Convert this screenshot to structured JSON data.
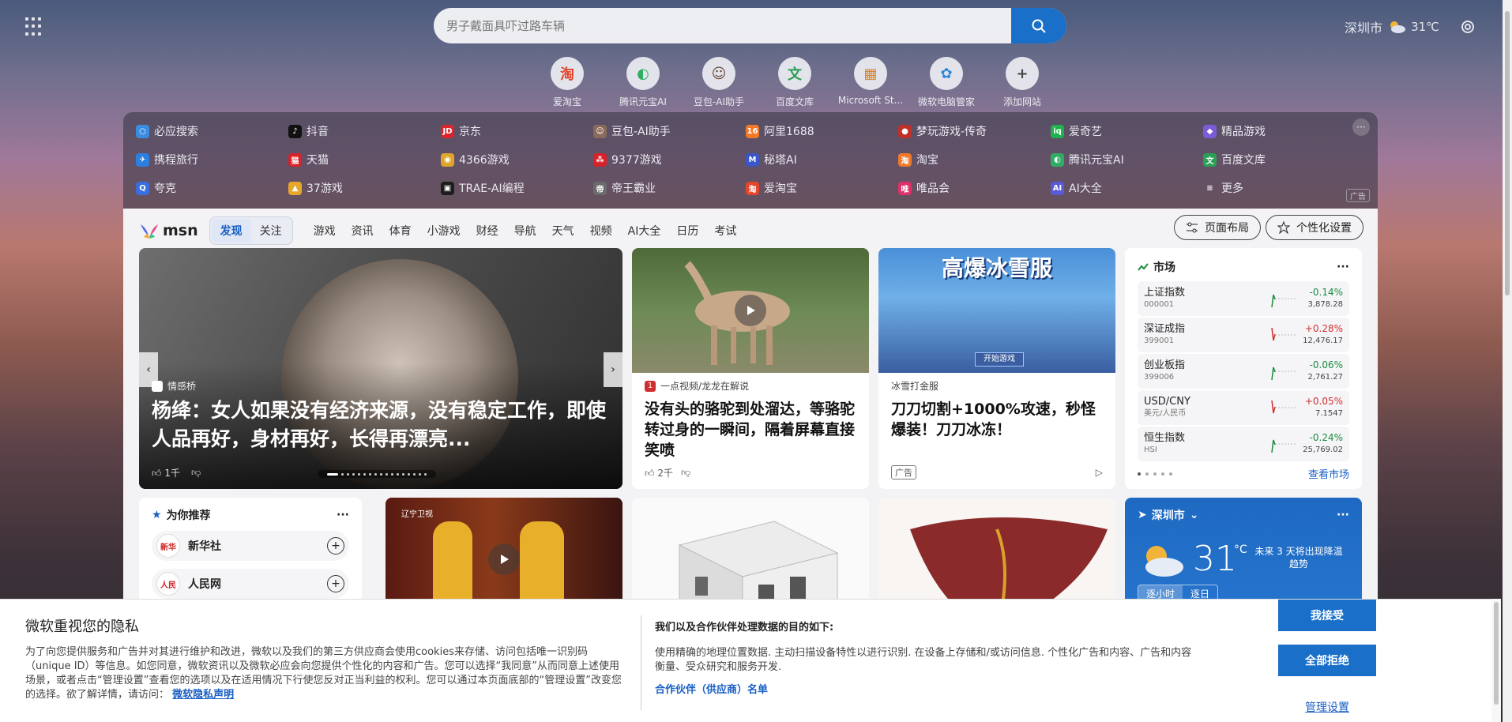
{
  "search": {
    "placeholder": "男子戴面具吓过路车辆"
  },
  "weather_top": {
    "city": "深圳市",
    "temp": "31℃"
  },
  "quick_links": [
    {
      "label": "爱淘宝",
      "glyph": "淘",
      "color": "#e2462b"
    },
    {
      "label": "腾讯元宝AI",
      "glyph": "◐",
      "color": "#2fae62"
    },
    {
      "label": "豆包-AI助手",
      "glyph": "☺",
      "color": "#6a4a3a"
    },
    {
      "label": "百度文库",
      "glyph": "文",
      "color": "#2aa055"
    },
    {
      "label": "Microsoft St...",
      "glyph": "▦",
      "color": "#d8842a"
    },
    {
      "label": "微软电脑管家",
      "glyph": "✿",
      "color": "#2b8ad8"
    },
    {
      "label": "添加网站",
      "glyph": "+",
      "color": "#444444"
    }
  ],
  "nav_grid": {
    "rows": [
      [
        {
          "label": "必应搜索",
          "glyph": "○",
          "color": "#3b8be0"
        },
        {
          "label": "抖音",
          "glyph": "♪",
          "color": "#111111"
        },
        {
          "label": "京东",
          "glyph": "JD",
          "color": "#d9262c"
        },
        {
          "label": "豆包-AI助手",
          "glyph": "☺",
          "color": "#8a6a5a"
        },
        {
          "label": "阿里1688",
          "glyph": "16",
          "color": "#f07a2a"
        },
        {
          "label": "梦玩游戏-传奇",
          "glyph": "●",
          "color": "#c0302a"
        },
        {
          "label": "爱奇艺",
          "glyph": "iq",
          "color": "#1fb14c"
        },
        {
          "label": "精品游戏",
          "glyph": "◆",
          "color": "#7b5cd6"
        }
      ],
      [
        {
          "label": "携程旅行",
          "glyph": "✈",
          "color": "#2a7fe0"
        },
        {
          "label": "天猫",
          "glyph": "猫",
          "color": "#d8222a"
        },
        {
          "label": "4366游戏",
          "glyph": "◉",
          "color": "#e0a62a"
        },
        {
          "label": "9377游戏",
          "glyph": "⁂",
          "color": "#d8222a"
        },
        {
          "label": "秘塔AI",
          "glyph": "M",
          "color": "#3a56c8"
        },
        {
          "label": "淘宝",
          "glyph": "淘",
          "color": "#f07a2a"
        },
        {
          "label": "腾讯元宝AI",
          "glyph": "◐",
          "color": "#2fae62"
        },
        {
          "label": "百度文库",
          "glyph": "文",
          "color": "#2aa055"
        }
      ],
      [
        {
          "label": "夸克",
          "glyph": "Q",
          "color": "#3a6ee0"
        },
        {
          "label": "37游戏",
          "glyph": "▲",
          "color": "#e6a72a"
        },
        {
          "label": "TRAE-AI编程",
          "glyph": "▣",
          "color": "#1d1d1d"
        },
        {
          "label": "帝王霸业",
          "glyph": "帝",
          "color": "#6b6b6b"
        },
        {
          "label": "爱淘宝",
          "glyph": "淘",
          "color": "#e2462b"
        },
        {
          "label": "唯品会",
          "glyph": "唯",
          "color": "#e0306a"
        },
        {
          "label": "AI大全",
          "glyph": "AI",
          "color": "#5a5ad8"
        },
        {
          "label": "更多",
          "glyph": "≡",
          "color": "transparent"
        }
      ]
    ],
    "ad_label": "广告"
  },
  "msn": {
    "logo_text": "msn",
    "tabs": [
      "发现",
      "关注"
    ],
    "categories": [
      "游戏",
      "资讯",
      "体育",
      "小游戏",
      "财经",
      "导航",
      "天气",
      "视频",
      "AI大全",
      "日历",
      "考试"
    ],
    "layout_btn": "页面布局",
    "personalize_btn": "个性化设置"
  },
  "hero": {
    "source": "情感桥",
    "title": "杨绛：女人如果没有经济来源，没有稳定工作，即使人品再好，身材再好，长得再漂亮...",
    "likes": "1千"
  },
  "camel_card": {
    "source": "一点视频/龙龙在解说",
    "title": "没有头的骆驼到处溜达，等骆驼转过身的一瞬间，隔着屏幕直接笑喷",
    "likes": "2千"
  },
  "game_ad": {
    "banner_text": "高爆冰雪服",
    "banner_btn": "开始游戏",
    "source": "冰雪打金服",
    "title": "刀刀切割+1000%攻速，秒怪爆装！刀刀冰冻！",
    "ad_tag": "广告"
  },
  "market": {
    "title": "市场",
    "rows": [
      {
        "name": "上证指数",
        "code": "000001",
        "change": "-0.14%",
        "value": "3,878.28",
        "dir": "neg"
      },
      {
        "name": "深证成指",
        "code": "399001",
        "change": "+0.28%",
        "value": "12,476.17",
        "dir": "pos"
      },
      {
        "name": "创业板指",
        "code": "399006",
        "change": "-0.06%",
        "value": "2,761.27",
        "dir": "neg"
      },
      {
        "name": "USD/CNY",
        "code": "美元/人民币",
        "change": "+0.05%",
        "value": "7.1547",
        "dir": "pos"
      },
      {
        "name": "恒生指数",
        "code": "HSI",
        "change": "-0.24%",
        "value": "25,769.02",
        "dir": "neg"
      }
    ],
    "link": "查看市场"
  },
  "recommend": {
    "title": "为你推荐",
    "items": [
      {
        "name": "新华社",
        "logo": "新华"
      },
      {
        "name": "人民网",
        "logo": "人民"
      }
    ]
  },
  "weather_card": {
    "city": "深圳市",
    "temp": "31",
    "unit": "°C",
    "forecast": "未来 3 天将出现降温趋势",
    "tabs": [
      "逐小时",
      "逐日"
    ]
  },
  "video_card": {
    "channel": "辽宁卫视"
  },
  "privacy": {
    "title": "微软重视您的隐私",
    "body": "为了向您提供服务和广告并对其进行维护和改进，微软以及我们的第三方供应商会使用cookies来存储、访问包括唯一识别码（unique ID）等信息。如您同意，微软资讯以及微软必应会向您提供个性化的内容和广告。您可以选择“我同意”从而同意上述使用场景，或者点击“管理设置”查看您的选项以及在适用情况下行使您反对正当利益的权利。您可以通过本页面底部的“管理设置”改变您的选择。欲了解详情，请访问：",
    "policy_link": "微软隐私声明",
    "purpose_title": "我们以及合作伙伴处理数据的目的如下:",
    "purpose_body": "使用精确的地理位置数据. 主动扫描设备特性以进行识别. 在设备上存储和/或访问信息. 个性化广告和内容、广告和内容衡量、受众研究和服务开发.",
    "partners_link": "合作伙伴（供应商）名单",
    "accept_btn": "我接受",
    "reject_btn": "全部拒绝",
    "manage_link": "管理设置"
  }
}
